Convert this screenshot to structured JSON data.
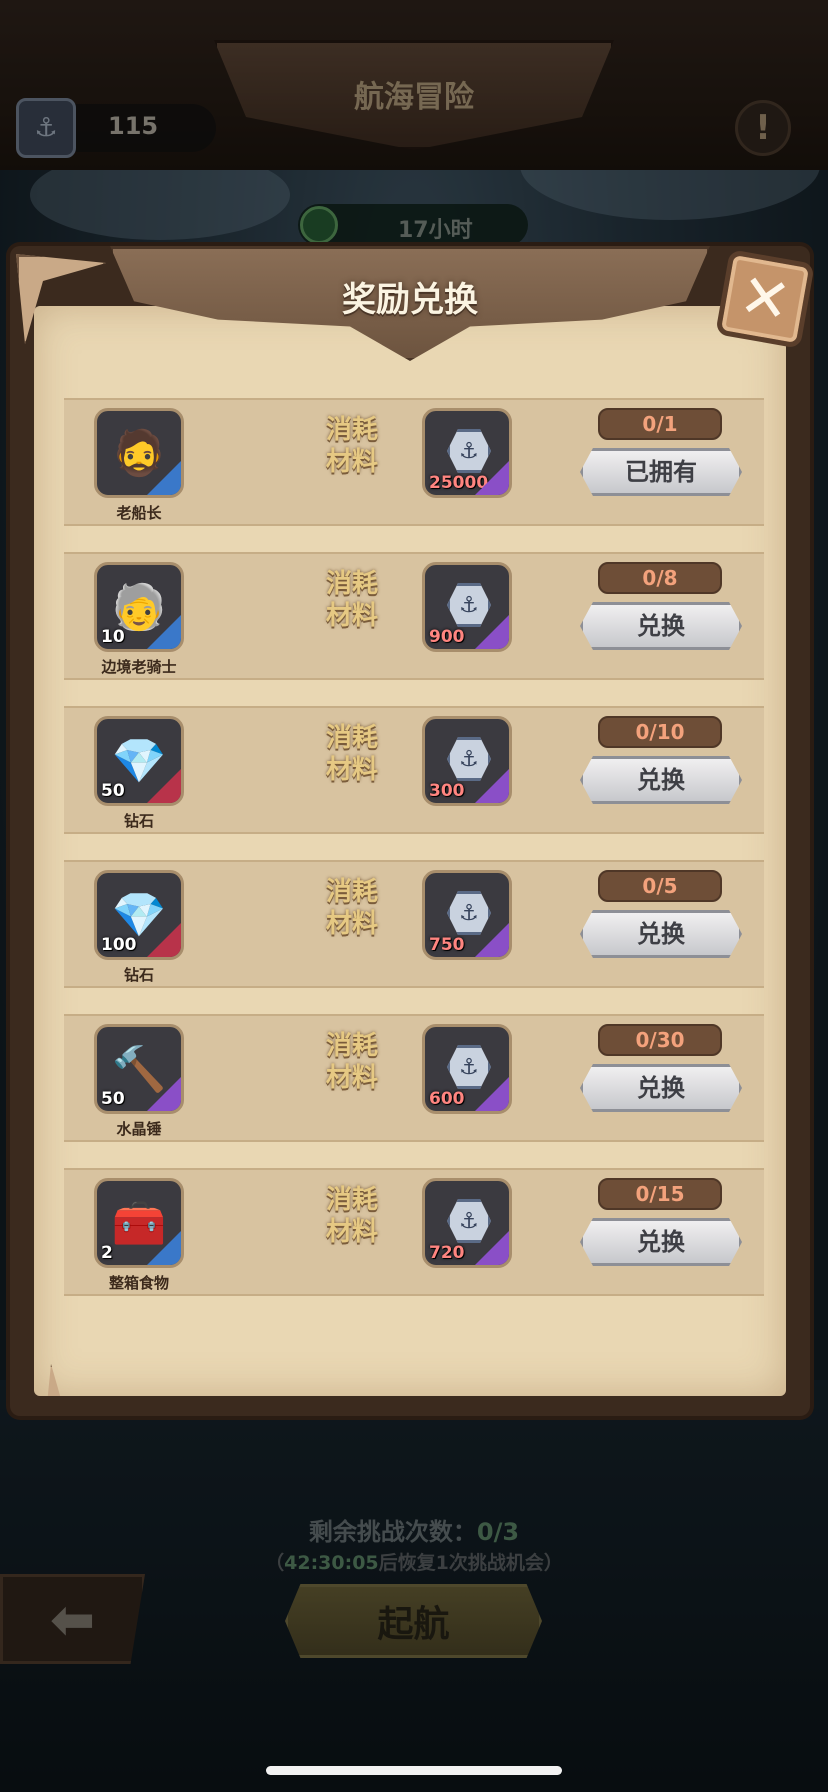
{
  "header": {
    "title": "航海冒险",
    "anchor_count": "115",
    "timer": "17小时",
    "alert_glyph": "!"
  },
  "modal": {
    "title": "奖励兑换",
    "close_glyph": "✕",
    "cost_label": "消耗材料",
    "rows": [
      {
        "name": "老船长",
        "qty": "",
        "glyph": "🧔",
        "rarity": "blue",
        "cost": "25000",
        "limit": "0/1",
        "button": "已拥有"
      },
      {
        "name": "边境老骑士",
        "qty": "10",
        "glyph": "🧓",
        "rarity": "blue",
        "cost": "900",
        "limit": "0/8",
        "button": "兑换"
      },
      {
        "name": "钻石",
        "qty": "50",
        "glyph": "💎",
        "rarity": "red",
        "cost": "300",
        "limit": "0/10",
        "button": "兑换"
      },
      {
        "name": "钻石",
        "qty": "100",
        "glyph": "💎",
        "rarity": "red",
        "cost": "750",
        "limit": "0/5",
        "button": "兑换"
      },
      {
        "name": "水晶锤",
        "qty": "50",
        "glyph": "🔨",
        "rarity": "purple",
        "cost": "600",
        "limit": "0/30",
        "button": "兑换"
      },
      {
        "name": "整箱食物",
        "qty": "2",
        "glyph": "🧰",
        "rarity": "blue",
        "cost": "720",
        "limit": "0/15",
        "button": "兑换"
      }
    ]
  },
  "footer": {
    "remain_label": "剩余挑战次数：",
    "remain_value": "0/3",
    "recover_prefix": "（",
    "recover_time": "42:30:05",
    "recover_suffix": "后恢复1次挑战机会）",
    "sail_button": "起航",
    "back_glyph": "⬅"
  },
  "colors": {
    "panel": "#e9d7b3",
    "frame": "#3b2a1e",
    "limit_text": "#f3a27c",
    "cost_amount": "#ff8580"
  }
}
